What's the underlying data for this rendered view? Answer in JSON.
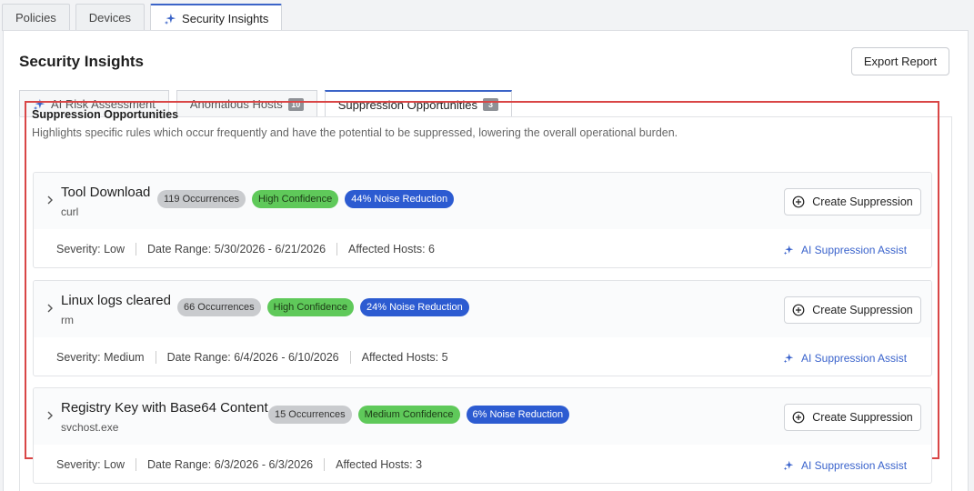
{
  "top_tabs": [
    {
      "label": "Policies"
    },
    {
      "label": "Devices"
    },
    {
      "label": "Security Insights"
    }
  ],
  "page": {
    "title": "Security Insights",
    "export_label": "Export Report"
  },
  "sub_tabs": [
    {
      "label": "AI Risk Assessment"
    },
    {
      "label": "Anomalous Hosts",
      "count": "10"
    },
    {
      "label": "Suppression Opportunities",
      "count": "3"
    }
  ],
  "section": {
    "title": "Suppression Opportunities",
    "description": "Highlights specific rules which occur frequently and have the potential to be suppressed, lowering the overall operational burden."
  },
  "cards": [
    {
      "title": "Tool Download",
      "subtitle": "curl",
      "occurrences": "119 Occurrences",
      "confidence": "High Confidence",
      "noise": "44% Noise Reduction",
      "severity": "Severity: Low",
      "date_range": "Date Range: 5/30/2026 - 6/21/2026",
      "hosts": "Affected Hosts: 6",
      "create_label": "Create Suppression",
      "assist_label": "AI Suppression Assist"
    },
    {
      "title": "Linux logs cleared",
      "subtitle": "rm",
      "occurrences": "66 Occurrences",
      "confidence": "High Confidence",
      "noise": "24% Noise Reduction",
      "severity": "Severity: Medium",
      "date_range": "Date Range: 6/4/2026 - 6/10/2026",
      "hosts": "Affected Hosts: 5",
      "create_label": "Create Suppression",
      "assist_label": "AI Suppression Assist"
    },
    {
      "title": "Registry Key with Base64 Content",
      "subtitle": "svchost.exe",
      "occurrences": "15 Occurrences",
      "confidence": "Medium Confidence",
      "noise": "6% Noise Reduction",
      "severity": "Severity: Low",
      "date_range": "Date Range: 6/3/2026 - 6/3/2026",
      "hosts": "Affected Hosts: 3",
      "create_label": "Create Suppression",
      "assist_label": "AI Suppression Assist"
    }
  ],
  "colors": {
    "accent": "#3b64c8",
    "highlight_border": "#d94646",
    "pill_green": "#5fc95a",
    "pill_blue": "#2c5bd1",
    "pill_grey": "#c9cbce"
  },
  "icons": {
    "ai": "sparkle-icon",
    "expand": "chevron-right-icon",
    "create": "plus-circle-icon"
  }
}
